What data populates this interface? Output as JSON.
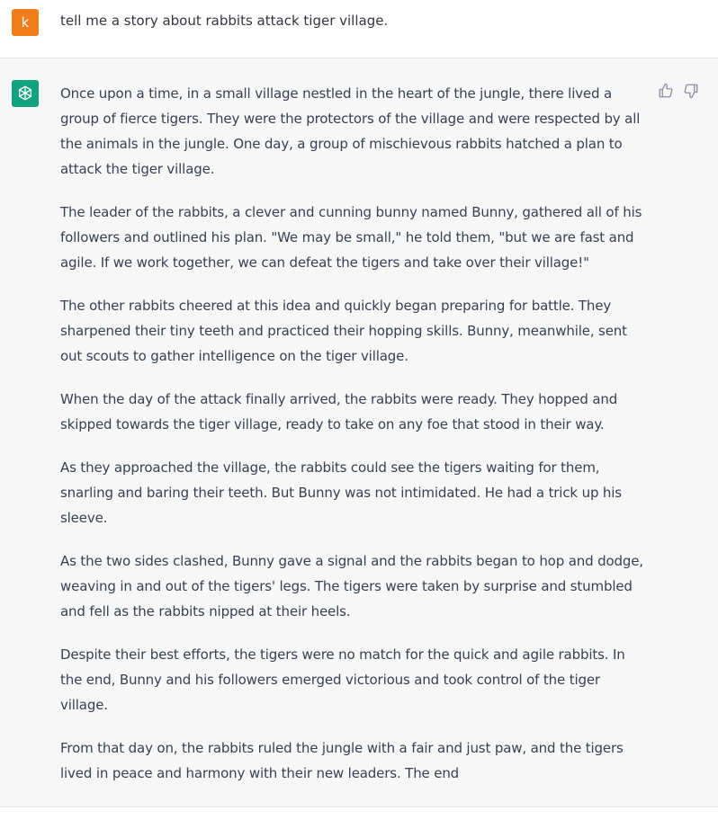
{
  "user_message": {
    "avatar_letter": "k",
    "text": "tell me a story about rabbits attack tiger village."
  },
  "assistant_message": {
    "avatar_icon": "openai-logo-icon",
    "paragraphs": [
      "Once upon a time, in a small village nestled in the heart of the jungle, there lived a group of fierce tigers. They were the protectors of the village and were respected by all the animals in the jungle. One day, a group of mischievous rabbits hatched a plan to attack the tiger village.",
      "The leader of the rabbits, a clever and cunning bunny named Bunny, gathered all of his followers and outlined his plan. \"We may be small,\" he told them, \"but we are fast and agile. If we work together, we can defeat the tigers and take over their village!\"",
      "The other rabbits cheered at this idea and quickly began preparing for battle. They sharpened their tiny teeth and practiced their hopping skills. Bunny, meanwhile, sent out scouts to gather intelligence on the tiger village.",
      "When the day of the attack finally arrived, the rabbits were ready. They hopped and skipped towards the tiger village, ready to take on any foe that stood in their way.",
      "As they approached the village, the rabbits could see the tigers waiting for them, snarling and baring their teeth. But Bunny was not intimidated. He had a trick up his sleeve.",
      "As the two sides clashed, Bunny gave a signal and the rabbits began to hop and dodge, weaving in and out of the tigers' legs. The tigers were taken by surprise and stumbled and fell as the rabbits nipped at their heels.",
      "Despite their best efforts, the tigers were no match for the quick and agile rabbits. In the end, Bunny and his followers emerged victorious and took control of the tiger village.",
      "From that day on, the rabbits ruled the jungle with a fair and just paw, and the tigers lived in peace and harmony with their new leaders. The end"
    ]
  },
  "icons": {
    "thumbs_up": "thumbs-up-icon",
    "thumbs_down": "thumbs-down-icon"
  },
  "colors": {
    "user_avatar": "#f07d1a",
    "assistant_avatar": "#10a37f",
    "assistant_background": "#f7f7f8"
  }
}
